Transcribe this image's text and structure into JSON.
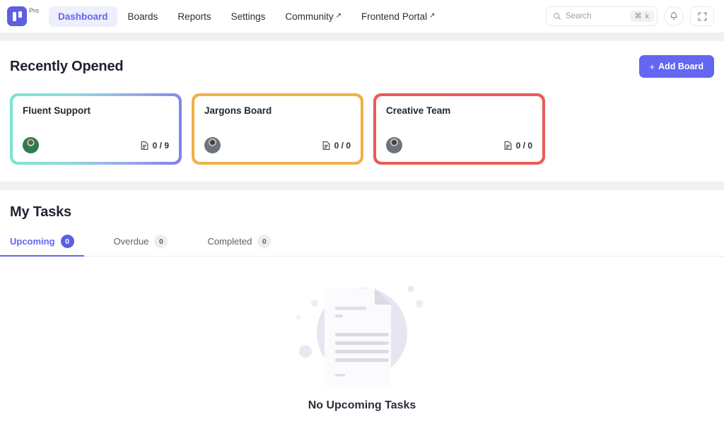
{
  "topbar": {
    "logo_icon": "app-logo-icon",
    "plan_label": "Pro",
    "nav": [
      {
        "label": "Dashboard",
        "active": true,
        "external": false
      },
      {
        "label": "Boards",
        "active": false,
        "external": false
      },
      {
        "label": "Reports",
        "active": false,
        "external": false
      },
      {
        "label": "Settings",
        "active": false,
        "external": false
      },
      {
        "label": "Community",
        "active": false,
        "external": true
      },
      {
        "label": "Frontend Portal",
        "active": false,
        "external": true
      }
    ],
    "search": {
      "placeholder": "Search",
      "value": "",
      "shortcut": "⌘ k",
      "icon": "search-icon"
    },
    "notifications_icon": "bell-icon",
    "fullscreen_icon": "fullscreen-icon"
  },
  "recently_opened": {
    "title": "Recently Opened",
    "add_board_label": "Add Board",
    "add_board_plus": "+",
    "boards": [
      {
        "title": "Fluent Support",
        "count": "0 / 9",
        "avatar": "user-avatar",
        "accent": "#7ae7cf"
      },
      {
        "title": "Jargons Board",
        "count": "0 / 0",
        "avatar": "user-avatar",
        "accent": "#f0b14a"
      },
      {
        "title": "Creative Team",
        "count": "0 / 0",
        "avatar": "user-avatar",
        "accent": "#ec5a5a"
      }
    ]
  },
  "my_tasks": {
    "title": "My Tasks",
    "tabs": [
      {
        "label": "Upcoming",
        "count": "0",
        "active": true
      },
      {
        "label": "Overdue",
        "count": "0",
        "active": false
      },
      {
        "label": "Completed",
        "count": "0",
        "active": false
      }
    ],
    "empty_state": {
      "illustration": "empty-document-illustration",
      "title": "No Upcoming Tasks"
    }
  },
  "colors": {
    "accent": "#6366f1",
    "accent_deep": "#5b5fe0",
    "page_bg": "#f0f0f0",
    "panel": "#ffffff"
  }
}
